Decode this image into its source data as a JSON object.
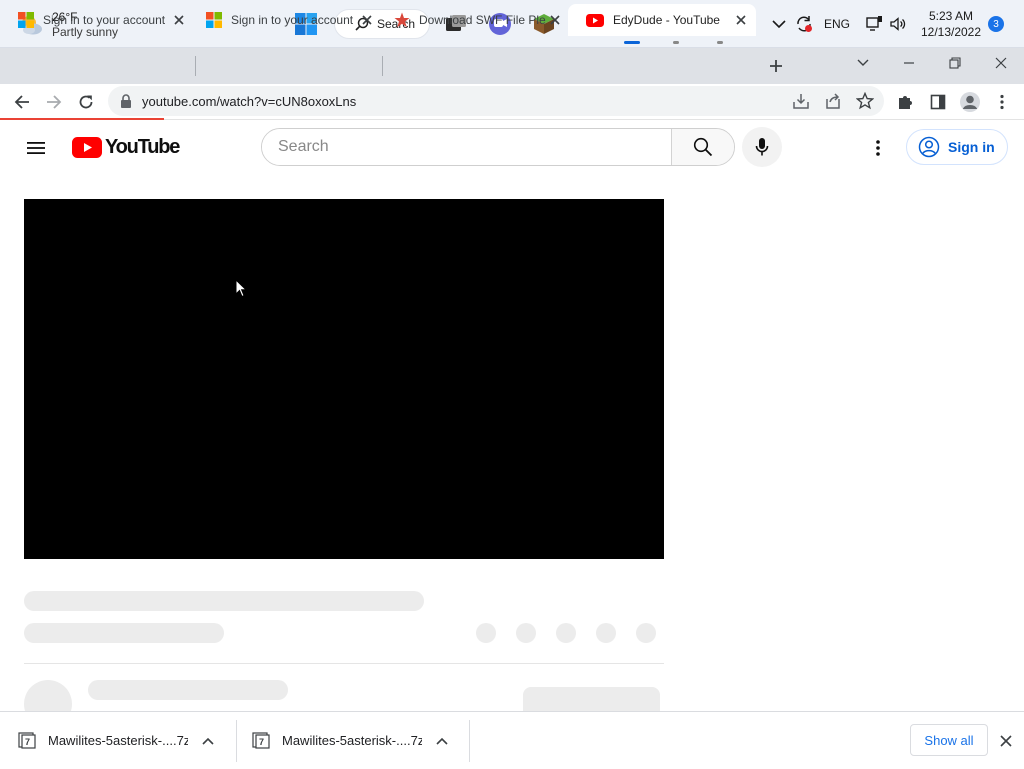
{
  "taskbar": {
    "weather": {
      "temp": "26°F",
      "condition": "Partly sunny"
    },
    "search_label": "Search",
    "language": "ENG",
    "time": "5:23 AM",
    "date": "12/13/2022",
    "notification_count": "3"
  },
  "browser": {
    "tabs": [
      {
        "title": "Sign in to your account",
        "icon": "microsoft-logo-icon",
        "active": false
      },
      {
        "title": "Sign in to your account",
        "icon": "microsoft-logo-icon",
        "active": false
      },
      {
        "title": "Download SWF File Ple",
        "icon": "star-favicon-icon",
        "active": false
      },
      {
        "title": "EdyDude - YouTube",
        "icon": "youtube-favicon-icon",
        "active": true
      }
    ],
    "url": "youtube.com/watch?v=cUN8oxoxLns"
  },
  "youtube": {
    "logo_text": "YouTube",
    "search_placeholder": "Search",
    "signin_label": "Sign in"
  },
  "downloads": {
    "items": [
      {
        "filename": "Mawilites-5asterisk-....7z"
      },
      {
        "filename": "Mawilites-5asterisk-....7z"
      }
    ],
    "show_all_label": "Show all"
  },
  "colors": {
    "youtube_red": "#ff0000",
    "link_blue": "#065fd4",
    "chrome_accent": "#1a73e8",
    "loading_bar": "#ea4335"
  }
}
